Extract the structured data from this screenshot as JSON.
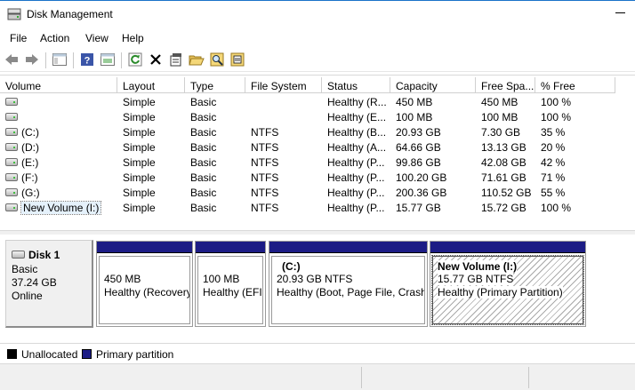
{
  "window": {
    "title": "Disk Management"
  },
  "menu": [
    "File",
    "Action",
    "View",
    "Help"
  ],
  "toolbar": {
    "icons": [
      "back-arrow-icon",
      "forward-arrow-icon",
      "console-tree-icon",
      "help-icon",
      "action-pane-icon",
      "refresh-icon",
      "delete-icon",
      "properties-icon",
      "open-folder-icon",
      "explore-icon",
      "disk-properties-icon"
    ]
  },
  "volumes": {
    "headers": [
      "Volume",
      "Layout",
      "Type",
      "File System",
      "Status",
      "Capacity",
      "Free Spa...",
      "% Free"
    ],
    "rows": [
      [
        "",
        "Simple",
        "Basic",
        "",
        "Healthy (R...",
        "450 MB",
        "450 MB",
        "100 %"
      ],
      [
        "",
        "Simple",
        "Basic",
        "",
        "Healthy (E...",
        "100 MB",
        "100 MB",
        "100 %"
      ],
      [
        "(C:)",
        "Simple",
        "Basic",
        "NTFS",
        "Healthy (B...",
        "20.93 GB",
        "7.30 GB",
        "35 %"
      ],
      [
        "(D:)",
        "Simple",
        "Basic",
        "NTFS",
        "Healthy (A...",
        "64.66 GB",
        "13.13 GB",
        "20 %"
      ],
      [
        "(E:)",
        "Simple",
        "Basic",
        "NTFS",
        "Healthy (P...",
        "99.86 GB",
        "42.08 GB",
        "42 %"
      ],
      [
        "(F:)",
        "Simple",
        "Basic",
        "NTFS",
        "Healthy (P...",
        "100.20 GB",
        "71.61 GB",
        "71 %"
      ],
      [
        "(G:)",
        "Simple",
        "Basic",
        "NTFS",
        "Healthy (P...",
        "200.36 GB",
        "110.52 GB",
        "55 %"
      ],
      [
        "New Volume (I:)",
        "Simple",
        "Basic",
        "NTFS",
        "Healthy (P...",
        "15.77 GB",
        "15.72 GB",
        "100 %"
      ]
    ]
  },
  "disk": {
    "name": "Disk 1",
    "type": "Basic",
    "size": "37.24 GB",
    "state": "Online",
    "partitions": [
      {
        "title": "",
        "size": "450 MB",
        "status": "Healthy (Recovery"
      },
      {
        "title": "",
        "size": "100 MB",
        "status": "Healthy (EFI"
      },
      {
        "title": "(C:)",
        "size": "20.93 GB NTFS",
        "status": "Healthy (Boot, Page File, Crash"
      },
      {
        "title": "New Volume  (I:)",
        "size": "15.77 GB NTFS",
        "status": "Healthy (Primary Partition)"
      }
    ]
  },
  "legend": [
    {
      "label": "Unallocated",
      "color": "#000000"
    },
    {
      "label": "Primary partition",
      "color": "#1c1c85"
    }
  ],
  "colors": {
    "partition_bar": "#1c1c85",
    "selected_row": "#e5f1fb"
  }
}
